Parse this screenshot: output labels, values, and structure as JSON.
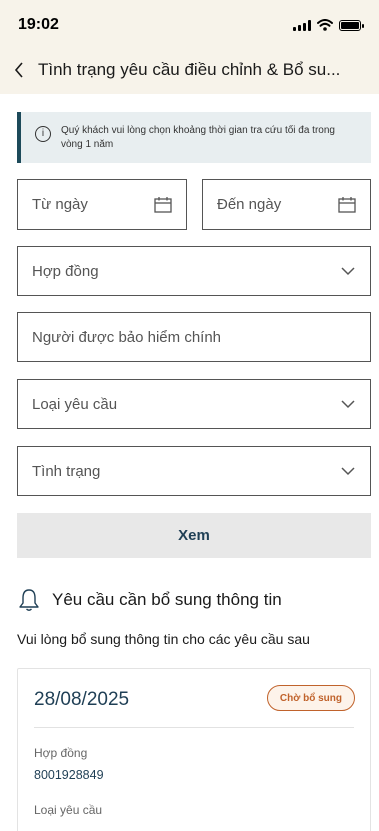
{
  "status": {
    "time": "19:02"
  },
  "header": {
    "title": "Tình trạng yêu cầu điều chỉnh & Bổ su..."
  },
  "info": {
    "message": "Quý khách vui lòng chọn khoảng thời gian tra cứu tối đa trong vòng 1 năm"
  },
  "filters": {
    "from_date": "Từ ngày",
    "to_date": "Đến ngày",
    "contract": "Hợp đồng",
    "insured": "Người được bảo hiểm chính",
    "request_type": "Loại yêu cầu",
    "status": "Tình trạng"
  },
  "actions": {
    "view_label": "Xem"
  },
  "section": {
    "title": "Yêu cầu cần bổ sung thông tin",
    "subtitle": "Vui lòng bổ sung thông tin cho các yêu cầu sau"
  },
  "request_card": {
    "date": "28/08/2025",
    "status_badge": "Chờ bổ sung",
    "contract_label": "Hợp đồng",
    "contract_value": "8001928849",
    "request_type_label": "Loại yêu cầu"
  },
  "colors": {
    "accent": "#1f3f55",
    "badge": "#c0622b",
    "header_bg": "#f7f3ea"
  }
}
